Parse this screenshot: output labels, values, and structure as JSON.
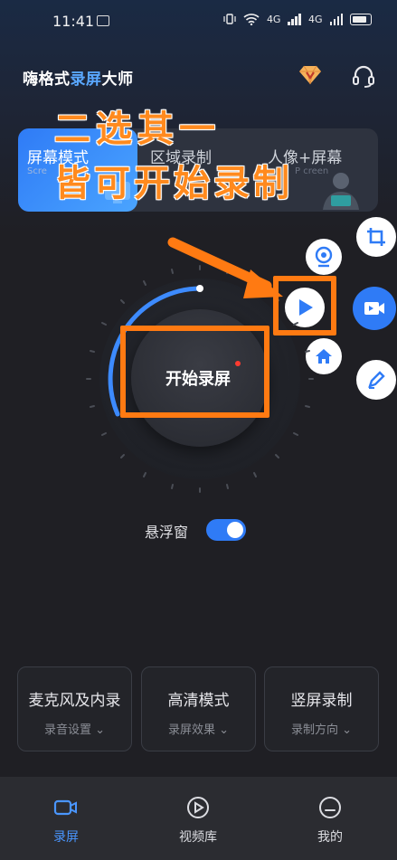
{
  "status": {
    "time": "11:41",
    "net1": "4G",
    "net2": "4G"
  },
  "header": {
    "title_part1": "嗨格式",
    "title_part2": "录屏",
    "title_part3": "大师"
  },
  "modes": [
    {
      "title": "屏幕模式",
      "sub": "Scre"
    },
    {
      "title": "区域录制",
      "sub": ""
    },
    {
      "title": "人像+屏幕",
      "sub": "P   creen"
    }
  ],
  "overlay": {
    "line1": "二选其一",
    "line2": "皆可开始录制"
  },
  "record": {
    "label": "开始录屏"
  },
  "float_window": {
    "label": "悬浮窗",
    "enabled": true
  },
  "cards": [
    {
      "title": "麦克风及内录",
      "sub": "录音设置"
    },
    {
      "title": "高清模式",
      "sub": "录屏效果"
    },
    {
      "title": "竖屏录制",
      "sub": "录制方向"
    }
  ],
  "nav": [
    {
      "label": "录屏",
      "active": true
    },
    {
      "label": "视频库",
      "active": false
    },
    {
      "label": "我的",
      "active": false
    }
  ],
  "colors": {
    "accent": "#2f7bf6",
    "annotation": "#ff7a12",
    "background": "#1f1f24"
  }
}
